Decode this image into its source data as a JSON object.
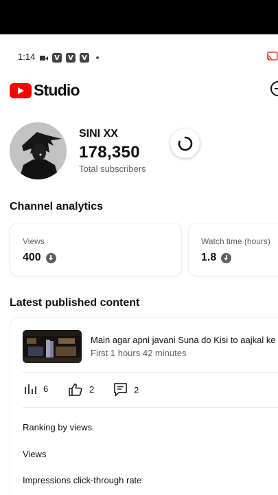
{
  "status_bar": {
    "time": "1:14",
    "notif_badges": [
      "V",
      "V",
      "V"
    ]
  },
  "header": {
    "logo_text": "Studio",
    "logo_icon": "youtube-play-icon",
    "account_icon": "account-icon"
  },
  "channel": {
    "name": "SINI XX",
    "subscribers": "178,350",
    "subscribers_label": "Total subscribers"
  },
  "analytics": {
    "title": "Channel analytics",
    "cards": [
      {
        "label": "Views",
        "value": "400",
        "trend_icon": "arrow-down-circle-icon"
      },
      {
        "label": "Watch time (hours)",
        "value": "1.8",
        "trend_icon": "arrow-down-circle-icon"
      }
    ]
  },
  "latest": {
    "title": "Latest published content",
    "video": {
      "title": "Main agar apni javani Suna do Kisi to aajkal ke la",
      "subtitle": "First 1 hours 42 minutes",
      "views": "6",
      "likes": "2",
      "comments": "2"
    },
    "rows": [
      "Ranking by views",
      "Views",
      "Impressions click-through rate"
    ]
  },
  "colors": {
    "brand_red": "#ff0000",
    "text_primary": "#0f0f0f",
    "text_secondary": "#606060"
  }
}
